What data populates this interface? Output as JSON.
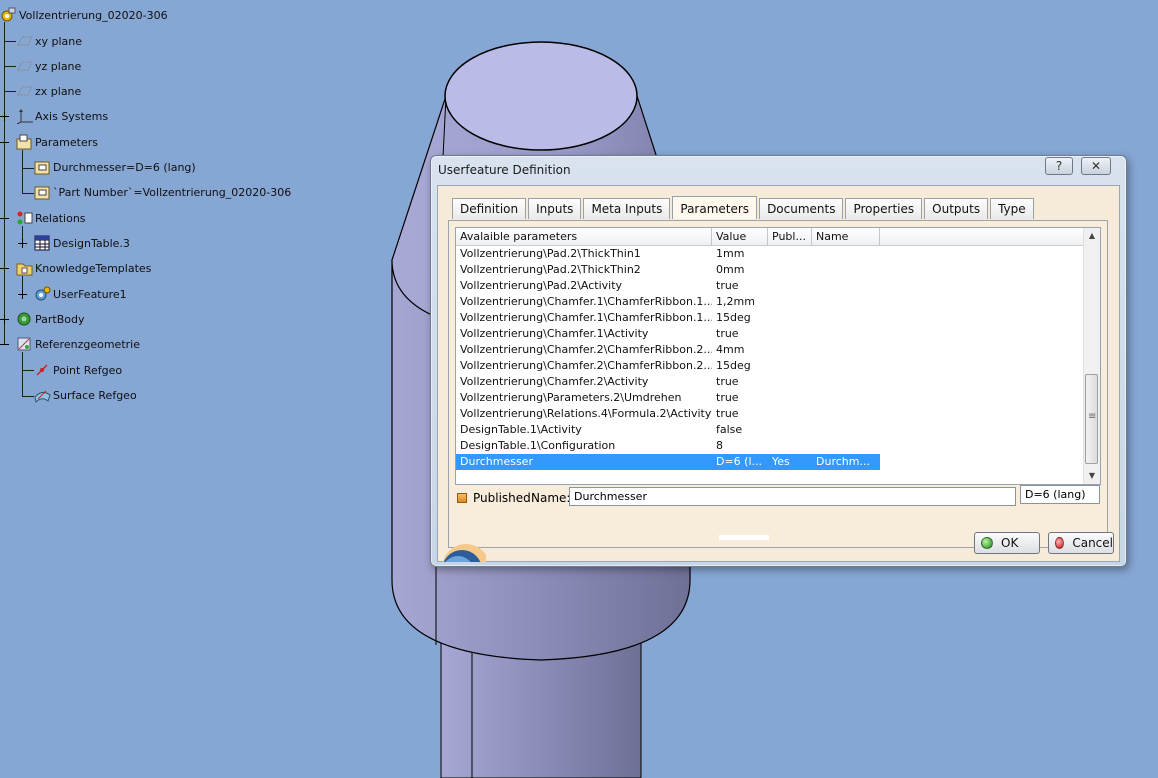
{
  "tree": {
    "root": "Vollzentrierung_02020-306",
    "items": [
      "xy plane",
      "yz plane",
      "zx plane",
      "Axis Systems",
      "Parameters",
      "Durchmesser=D=6 (lang)",
      "`Part Number`=Vollzentrierung_02020-306",
      "Relations",
      "DesignTable.3",
      "KnowledgeTemplates",
      "UserFeature1",
      "PartBody",
      "Referenzgeometrie",
      "Point Refgeo",
      "Surface Refgeo"
    ]
  },
  "dialog": {
    "title": "Userfeature Definition",
    "help": "?",
    "close": "✕",
    "tabs": [
      "Definition",
      "Inputs",
      "Meta Inputs",
      "Parameters",
      "Documents",
      "Properties",
      "Outputs",
      "Type"
    ],
    "active_tab": "Parameters",
    "columns": [
      "Avalaible parameters",
      "Value",
      "Publ...",
      "Name"
    ],
    "rows": [
      {
        "param": "Vollzentrierung\\Pad.2\\ThickThin1",
        "value": "1mm",
        "published": "",
        "name": ""
      },
      {
        "param": "Vollzentrierung\\Pad.2\\ThickThin2",
        "value": "0mm",
        "published": "",
        "name": ""
      },
      {
        "param": "Vollzentrierung\\Pad.2\\Activity",
        "value": "true",
        "published": "",
        "name": ""
      },
      {
        "param": "Vollzentrierung\\Chamfer.1\\ChamferRibbon.1...",
        "value": "1,2mm",
        "published": "",
        "name": ""
      },
      {
        "param": "Vollzentrierung\\Chamfer.1\\ChamferRibbon.1...",
        "value": "15deg",
        "published": "",
        "name": ""
      },
      {
        "param": "Vollzentrierung\\Chamfer.1\\Activity",
        "value": "true",
        "published": "",
        "name": ""
      },
      {
        "param": "Vollzentrierung\\Chamfer.2\\ChamferRibbon.2...",
        "value": "4mm",
        "published": "",
        "name": ""
      },
      {
        "param": "Vollzentrierung\\Chamfer.2\\ChamferRibbon.2...",
        "value": "15deg",
        "published": "",
        "name": ""
      },
      {
        "param": "Vollzentrierung\\Chamfer.2\\Activity",
        "value": "true",
        "published": "",
        "name": ""
      },
      {
        "param": "Vollzentrierung\\Parameters.2\\Umdrehen",
        "value": "true",
        "published": "",
        "name": ""
      },
      {
        "param": "Vollzentrierung\\Relations.4\\Formula.2\\Activity",
        "value": "true",
        "published": "",
        "name": ""
      },
      {
        "param": "DesignTable.1\\Activity",
        "value": "false",
        "published": "",
        "name": ""
      },
      {
        "param": "DesignTable.1\\Configuration",
        "value": "8",
        "published": "",
        "name": ""
      },
      {
        "param": "Durchmesser",
        "value": "D=6 (l...",
        "published": "Yes",
        "name": "Durchm..."
      }
    ],
    "selected_row": 13,
    "published_label": "Published",
    "published_checked": true,
    "name_label": "Name:",
    "name_value": "Durchmesser",
    "value_field": "D=6 (lang)",
    "ok_label": "OK",
    "cancel_label": "Cancel"
  },
  "colors": {
    "background": "#86a6d4",
    "selection": "#3399ff",
    "dialog_client": "#f6ead8"
  }
}
